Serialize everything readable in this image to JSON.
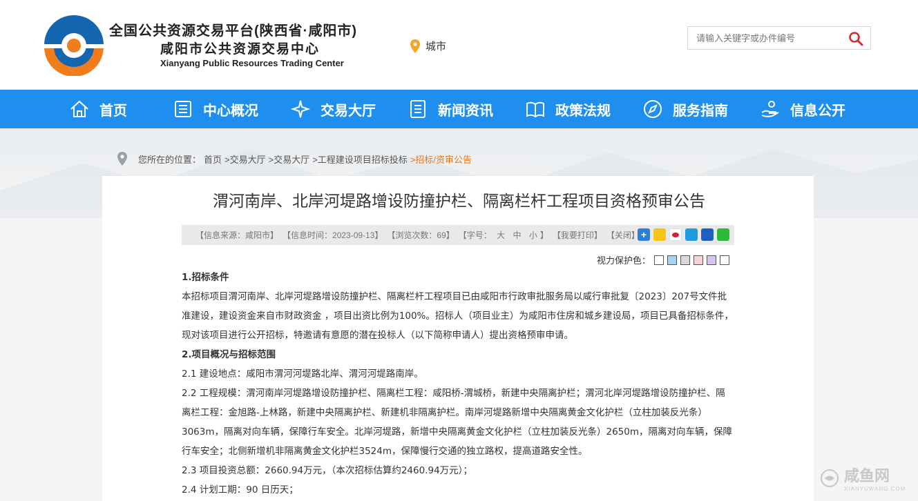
{
  "header": {
    "site_title": "全国公共资源交易平台(陕西省·咸阳市)",
    "site_subtitle": "咸阳市公共资源交易中心",
    "site_english": "Xianyang Public Resources Trading Center",
    "city_label": "城市",
    "search_placeholder": "请输入关键字或办件编号"
  },
  "nav": {
    "items": [
      {
        "label": "首页",
        "icon": "home-icon"
      },
      {
        "label": "中心概况",
        "icon": "document-icon"
      },
      {
        "label": "交易大厅",
        "icon": "sparkle-icon"
      },
      {
        "label": "新闻资讯",
        "icon": "list-icon"
      },
      {
        "label": "政策法规",
        "icon": "book-icon"
      },
      {
        "label": "服务指南",
        "icon": "compass-icon"
      },
      {
        "label": "信息公开",
        "icon": "hand-icon"
      }
    ]
  },
  "breadcrumb": {
    "prefix": "您所在的位置：",
    "items": [
      "首页",
      ">交易大厅",
      ">交易大厅",
      ">工程建设项目招标投标",
      ">招标/资审公告"
    ]
  },
  "article": {
    "title": "渭河南岸、北岸河堤路增设防撞护栏、隔离栏杆工程项目资格预审公告",
    "meta": {
      "source": "【信息来源：咸阳市】",
      "time": "【信息时间：2023-09-13】",
      "views": "【浏览次数：69】",
      "font_label": "【字号：",
      "font_large": "大",
      "font_mid": "中",
      "font_small": "小",
      "font_close": "】",
      "print": "【我要打印】",
      "close": "【关闭】"
    },
    "vision_label": "视力保护色：",
    "vision_colors": [
      "#ffffff",
      "#a6d3f0",
      "#d9d9d9",
      "#f7d2d6",
      "#d9c6ef",
      "#ffffff"
    ],
    "paragraphs": [
      {
        "text": "1.招标条件",
        "heading": true
      },
      {
        "text": "本招标项目渭河南岸、北岸河堤路增设防撞护栏、隔离栏杆工程项目已由咸阳市行政审批服务局以咸行审批复〔2023〕207号文件批准建设，建设资金来自市财政资金 ，项目出资比例为100%。招标人（项目业主）为咸阳市住房和城乡建设局，项目已具备招标条件，现对该项目进行公开招标，特邀请有意愿的潜在投标人（以下简称申请人）提出资格预审申请。",
        "heading": false
      },
      {
        "text": "2.项目概况与招标范围",
        "heading": true
      },
      {
        "text": "2.1 建设地点：咸阳市渭河河堤路北岸、渭河河堤路南岸。",
        "heading": false
      },
      {
        "text": "2.2 工程规模：渭河南岸河堤路增设防撞护栏、隔离栏工程：咸阳桥-渭城桥，新建中央隔离护栏；渭河北岸河堤路增设防撞护栏、隔离栏工程：金旭路-上林路，新建中央隔离护栏、新建机非隔离护栏。南岸河堤路新增中央隔离黄金文化护栏（立柱加装反光条）3063m，隔离对向车辆，保障行车安全。北岸河堤路，新增中央隔离黄金文化护栏（立柱加装反光条）2650m，隔离对向车辆，保障行车安全；北侧新增机非隔离黄金文化护栏3524m，保障慢行交通的独立路权，提高道路安全性。",
        "heading": false
      },
      {
        "text": "2.3 项目投资总额：2660.94万元，（本次招标估算约2460.94万元）；",
        "heading": false
      },
      {
        "text": "2.4 计划工期：90 日历天；",
        "heading": false
      }
    ]
  },
  "watermark": {
    "text": "咸鱼网",
    "sub": "XIANYUWANG.COM"
  },
  "colors": {
    "nav_bg": "#1e8fef",
    "logo_blue": "#1566b0",
    "logo_orange": "#f07c1e",
    "crumb_active": "#e2771c"
  }
}
